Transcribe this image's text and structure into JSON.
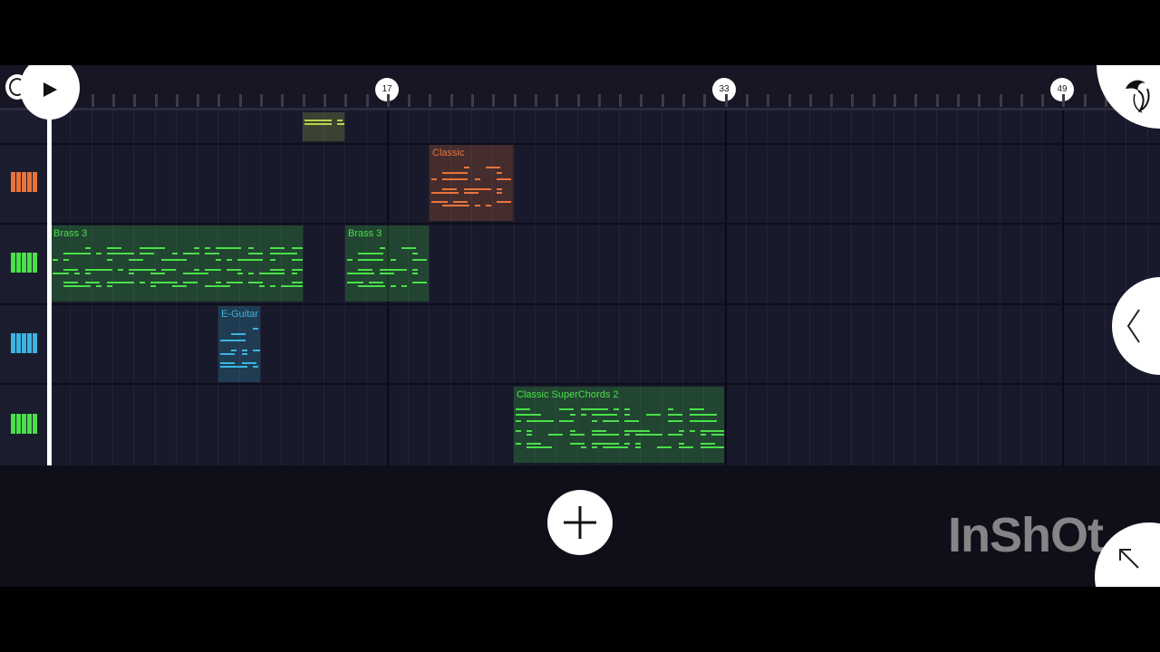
{
  "ruler": {
    "markers": [
      "17",
      "33",
      "49"
    ]
  },
  "tracks": [
    {
      "name": "track-1",
      "icon": "piano-keys-icon",
      "color": "#e8743a"
    },
    {
      "name": "track-2",
      "icon": "piano-keys-icon",
      "color": "#4ae04a"
    },
    {
      "name": "track-3",
      "icon": "piano-keys-icon",
      "color": "#3bb4e0"
    },
    {
      "name": "track-4",
      "icon": "piano-keys-icon",
      "color": "#4ae04a"
    }
  ],
  "clips": {
    "top": {
      "label": "",
      "color": "#b8d44a"
    },
    "classic": {
      "label": "Classic",
      "color": "#e8743a"
    },
    "brass_a": {
      "label": "Brass 3",
      "color": "#4ae04a"
    },
    "brass_b": {
      "label": "Brass 3",
      "color": "#4ae04a"
    },
    "eguitar": {
      "label": "E-Guitar",
      "color": "#3bb4e0"
    },
    "superchords": {
      "label": "Classic SuperChords 2",
      "color": "#4ae04a"
    }
  },
  "controls": {
    "play": "play-icon",
    "add": "plus-icon",
    "logo": "fl-studio-logo-icon",
    "side": "chevron-left-icon",
    "corner": "arrow-up-left-icon"
  },
  "watermark": "InShOt"
}
